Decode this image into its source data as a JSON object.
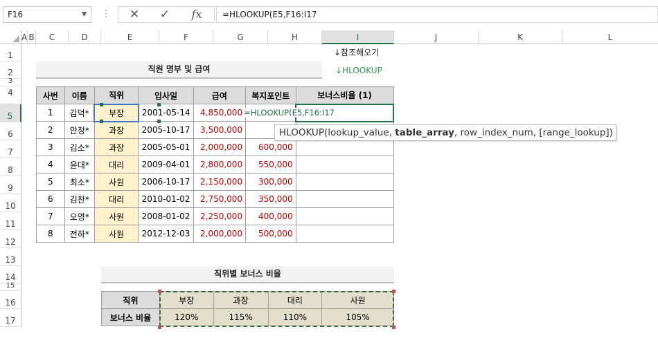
{
  "formula_bar": {
    "name_box": "F16",
    "cancel_symbol": "✕",
    "enter_symbol": "✓",
    "fx_label": "fx",
    "formula": "=HLOOKUP(E5,F16:I17"
  },
  "columns": [
    "A",
    "B",
    "C",
    "D",
    "E",
    "F",
    "G",
    "H",
    "I",
    "J",
    "K",
    "L"
  ],
  "rows": [
    "1",
    "2",
    "3",
    "4",
    "5",
    "6",
    "7",
    "8",
    "9",
    "10",
    "11",
    "12",
    "13",
    "14",
    "15",
    "16",
    "17"
  ],
  "notes": {
    "ref_note": "↓참조해오기",
    "func_note": "↓HLOOKUP"
  },
  "employee_table": {
    "title": "직원 명부 및 급여",
    "headers": [
      "사번",
      "이름",
      "직위",
      "입사일",
      "급여",
      "복지포인트",
      "보너스비율 (1)"
    ],
    "rows": [
      {
        "id": "1",
        "name": "김덕*",
        "position": "부장",
        "hire": "2001-05-14",
        "salary": "4,850,000",
        "points": "",
        "bonus": "=HLOOKUP(E5,F16:I17"
      },
      {
        "id": "2",
        "name": "안정*",
        "position": "과장",
        "hire": "2005-10-17",
        "salary": "3,500,000",
        "points": "",
        "bonus": ""
      },
      {
        "id": "3",
        "name": "김소*",
        "position": "과장",
        "hire": "2005-05-01",
        "salary": "2,000,000",
        "points": "600,000",
        "bonus": ""
      },
      {
        "id": "4",
        "name": "윤대*",
        "position": "대리",
        "hire": "2009-04-01",
        "salary": "2,800,000",
        "points": "550,000",
        "bonus": ""
      },
      {
        "id": "5",
        "name": "최소*",
        "position": "사원",
        "hire": "2006-10-17",
        "salary": "2,150,000",
        "points": "300,000",
        "bonus": ""
      },
      {
        "id": "6",
        "name": "김찬*",
        "position": "대리",
        "hire": "2010-01-02",
        "salary": "2,750,000",
        "points": "350,000",
        "bonus": ""
      },
      {
        "id": "7",
        "name": "오영*",
        "position": "사원",
        "hire": "2008-01-02",
        "salary": "2,250,000",
        "points": "400,000",
        "bonus": ""
      },
      {
        "id": "8",
        "name": "전하*",
        "position": "사원",
        "hire": "2012-12-03",
        "salary": "2,000,000",
        "points": "500,000",
        "bonus": ""
      }
    ]
  },
  "tooltip": {
    "fn": "HLOOKUP(",
    "a1": "lookup_value, ",
    "a2": "table_array",
    "a3": ", row_index_num, [range_lookup])"
  },
  "bonus_table": {
    "title": "직위별 보너스 비율",
    "row1_label": "직위",
    "row2_label": "보너스 비율",
    "positions": [
      "부장",
      "과장",
      "대리",
      "사원"
    ],
    "rates": [
      "120%",
      "115%",
      "110%",
      "105%"
    ]
  },
  "colors": {
    "excel_green": "#217346",
    "salary_red": "#c00000",
    "position_fill": "#fff2cc",
    "header_fill": "#dcdcdc",
    "bonus_range_fill": "#e2dfcc"
  }
}
